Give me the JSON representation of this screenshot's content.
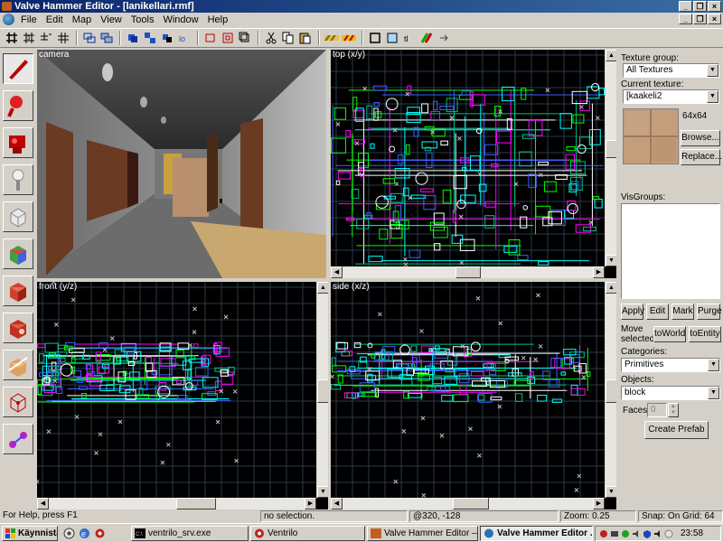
{
  "window": {
    "title": "Valve Hammer Editor - [lanikellari.rmf]"
  },
  "menu": [
    "File",
    "Edit",
    "Map",
    "View",
    "Tools",
    "Window",
    "Help"
  ],
  "viewports": {
    "camera": {
      "label": "camera"
    },
    "top": {
      "label": "top (x/y)"
    },
    "front": {
      "label": "front (y/z)"
    },
    "side": {
      "label": "side (x/z)"
    }
  },
  "texture_panel": {
    "group_label": "Texture group:",
    "group_value": "All Textures",
    "current_label": "Current texture:",
    "current_value": "[kaakeli2",
    "size": "64x64",
    "browse": "Browse...",
    "replace": "Replace..."
  },
  "visgroups": {
    "label": "VisGroups:",
    "buttons": [
      "Apply",
      "Edit",
      "Mark",
      "Purge"
    ]
  },
  "move_selected": {
    "label": "Move selected:",
    "to_world": "toWorld",
    "to_entity": "toEntity"
  },
  "categories": {
    "label": "Categories:",
    "value": "Primitives"
  },
  "objects": {
    "label": "Objects:",
    "value": "block"
  },
  "faces": {
    "label": "Faces:",
    "value": "0"
  },
  "create_prefab": "Create Prefab",
  "status": {
    "help": "For Help, press F1",
    "selection": "no selection.",
    "coords": "@320, -128",
    "zoom": "Zoom: 0.25",
    "snap": "Snap: On Grid: 64"
  },
  "taskbar": {
    "start": "Käynnistä",
    "tasks": [
      "ventrilo_srv.exe",
      "Ventrilo",
      "Valve Hammer Editor – ...",
      "Valve Hammer Editor ..."
    ],
    "clock": "23:58"
  },
  "colors": {
    "title_start": "#0a246a",
    "title_end": "#3a6ea5",
    "grid": "#2a3a4a",
    "wire_cyan": "#00ffff",
    "wire_green": "#00ff00",
    "wire_magenta": "#ff00ff",
    "wire_blue": "#4060ff"
  }
}
